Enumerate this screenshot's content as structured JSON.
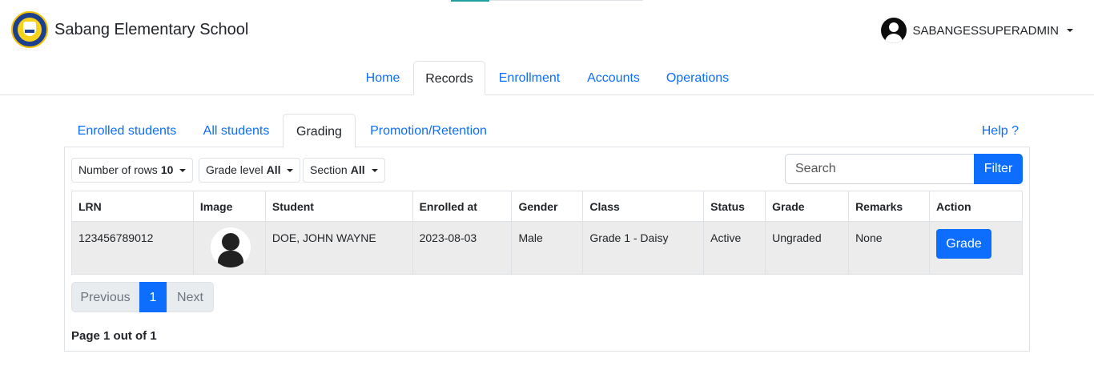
{
  "brand": {
    "title": "Sabang Elementary School",
    "logo_icon": "school-seal-logo"
  },
  "user": {
    "name": "SABANGESSUPERADMIN",
    "avatar_icon": "user-avatar-icon"
  },
  "main_nav": {
    "tabs": [
      {
        "label": "Home"
      },
      {
        "label": "Records",
        "active": true
      },
      {
        "label": "Enrollment"
      },
      {
        "label": "Accounts"
      },
      {
        "label": "Operations"
      }
    ]
  },
  "sub_nav": {
    "tabs": [
      {
        "label": "Enrolled students"
      },
      {
        "label": "All students"
      },
      {
        "label": "Grading",
        "active": true
      },
      {
        "label": "Promotion/Retention"
      }
    ],
    "help": "Help ?"
  },
  "filters": {
    "rows": {
      "label": "Number of rows",
      "value": "10"
    },
    "grade_level": {
      "label": "Grade level",
      "value": "All"
    },
    "section": {
      "label": "Section",
      "value": "All"
    },
    "search_placeholder": "Search",
    "filter_button": "Filter"
  },
  "table": {
    "headers": [
      "LRN",
      "Image",
      "Student",
      "Enrolled at",
      "Gender",
      "Class",
      "Status",
      "Grade",
      "Remarks",
      "Action"
    ],
    "rows": [
      {
        "lrn": "123456789012",
        "student": "DOE, JOHN WAYNE",
        "enrolled_at": "2023-08-03",
        "gender": "Male",
        "class": "Grade 1 - Daisy",
        "status": "Active",
        "grade": "Ungraded",
        "remarks": "None",
        "action": "Grade"
      }
    ]
  },
  "pagination": {
    "previous": "Previous",
    "current": "1",
    "next": "Next",
    "info": "Page 1 out of 1"
  },
  "colors": {
    "primary": "#0d6efd",
    "border": "#dee2e6",
    "row_bg": "#ececec"
  }
}
